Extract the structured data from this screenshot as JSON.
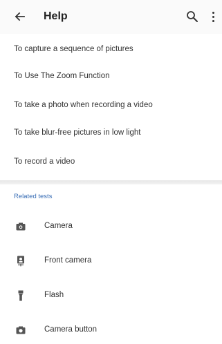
{
  "app_bar": {
    "title": "Help"
  },
  "articles": [
    "To capture a sequence of pictures",
    "To Use The Zoom Function",
    "To take a photo when recording a video",
    "To take blur-free pictures in low light",
    "To record a video"
  ],
  "related": {
    "header": "Related tests",
    "items": [
      {
        "label": "Camera",
        "icon": "camera-icon"
      },
      {
        "label": "Front camera",
        "icon": "front-camera-icon"
      },
      {
        "label": "Flash",
        "icon": "flash-icon"
      },
      {
        "label": "Camera button",
        "icon": "camera-button-icon"
      }
    ]
  },
  "colors": {
    "accent": "#3b6fb6",
    "icon": "#555555",
    "text": "#333333"
  }
}
